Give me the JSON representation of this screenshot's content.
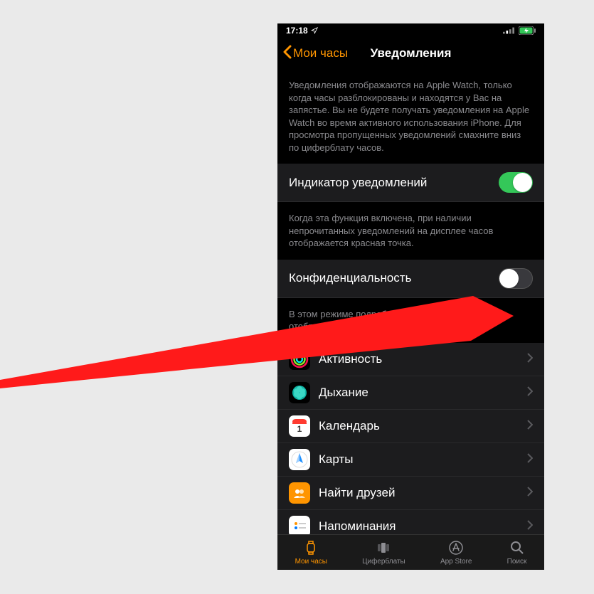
{
  "status": {
    "time": "17:18"
  },
  "nav": {
    "back": "Мои часы",
    "title": "Уведомления"
  },
  "intro": "Уведомления отображаются на Apple Watch, только когда часы разблокированы и находятся у Вас на запястье. Вы не будете получать уведомления на Apple Watch во время активного использования iPhone. Для просмотра пропущенных уведомлений смахните вниз по циферблату часов.",
  "toggle1": {
    "label": "Индикатор уведомлений",
    "on": true
  },
  "help1": "Когда эта функция включена, при наличии непрочитанных уведомлений на дисплее часов отображается красная точка.",
  "toggle2": {
    "label": "Конфиденциальность",
    "on": false
  },
  "help2": "В этом режиме подробности оповещения не будут отображаться, пока Вы его не коснетесь.",
  "apps": [
    {
      "label": "Активность"
    },
    {
      "label": "Дыхание"
    },
    {
      "label": "Календарь"
    },
    {
      "label": "Карты"
    },
    {
      "label": "Найти друзей"
    },
    {
      "label": "Напоминания"
    }
  ],
  "tabs": [
    {
      "label": "Мои часы"
    },
    {
      "label": "Циферблаты"
    },
    {
      "label": "App Store"
    },
    {
      "label": "Поиск"
    }
  ]
}
